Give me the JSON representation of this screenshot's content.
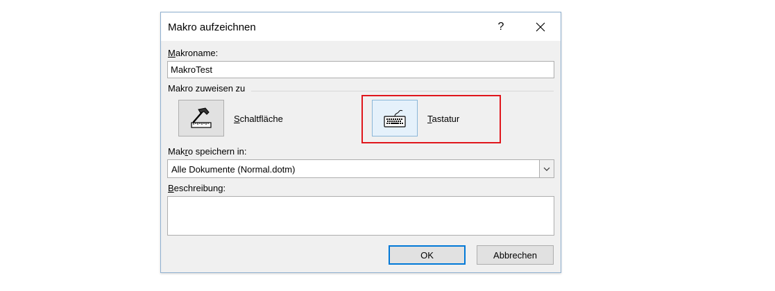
{
  "dialog": {
    "title": "Makro aufzeichnen",
    "help_label": "?",
    "macro_name": {
      "label_accel": "M",
      "label_rest": "akroname:",
      "value": "MakroTest"
    },
    "assign_group_label": "Makro zuweisen zu",
    "assign_button": {
      "label_accel": "S",
      "label_rest": "chaltfläche",
      "icon": "hammer-ruler-icon"
    },
    "assign_keyboard": {
      "label_accel": "T",
      "label_rest": "astatur",
      "icon": "keyboard-icon"
    },
    "store_in": {
      "label_pre": "Mak",
      "label_accel": "r",
      "label_post": "o speichern in:",
      "selected": "Alle Dokumente (Normal.dotm)"
    },
    "description": {
      "label_accel": "B",
      "label_rest": "eschreibung:",
      "value": ""
    },
    "ok_label": "OK",
    "cancel_label": "Abbrechen",
    "highlight_color": "#e0151b"
  }
}
